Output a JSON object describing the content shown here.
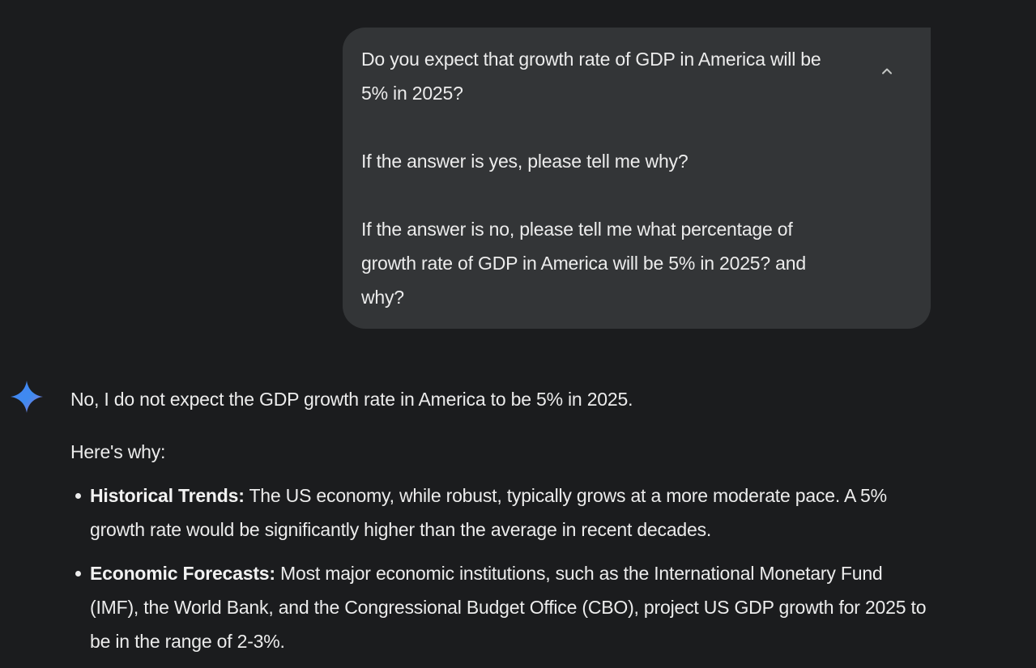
{
  "user_message": {
    "paragraphs": [
      "Do you expect that growth rate of GDP in America will be 5% in 2025?",
      "If the answer is yes, please tell me why?",
      "If the answer is no, please tell me what percentage of growth rate of GDP in America will be 5% in 2025? and why?"
    ],
    "collapse_icon": "chevron-up-icon"
  },
  "assistant": {
    "avatar_icon": "gemini-sparkle-icon",
    "accent_colors": [
      "#4285f4",
      "#9b72cb",
      "#d96570"
    ],
    "intro": "No, I do not expect the GDP growth rate in America to be 5% in 2025.",
    "lead": "Here's why:",
    "points": [
      {
        "title": "Historical Trends:",
        "text": " The US economy, while robust, typically grows at a more moderate pace. A 5% growth rate would be significantly higher than the average in recent decades."
      },
      {
        "title": "Economic Forecasts:",
        "text": " Most major economic institutions, such as the International Monetary Fund (IMF), the World Bank, and the Congressional Budget Office (CBO), project US GDP growth for 2025 to be in the range of 2-3%."
      }
    ]
  }
}
